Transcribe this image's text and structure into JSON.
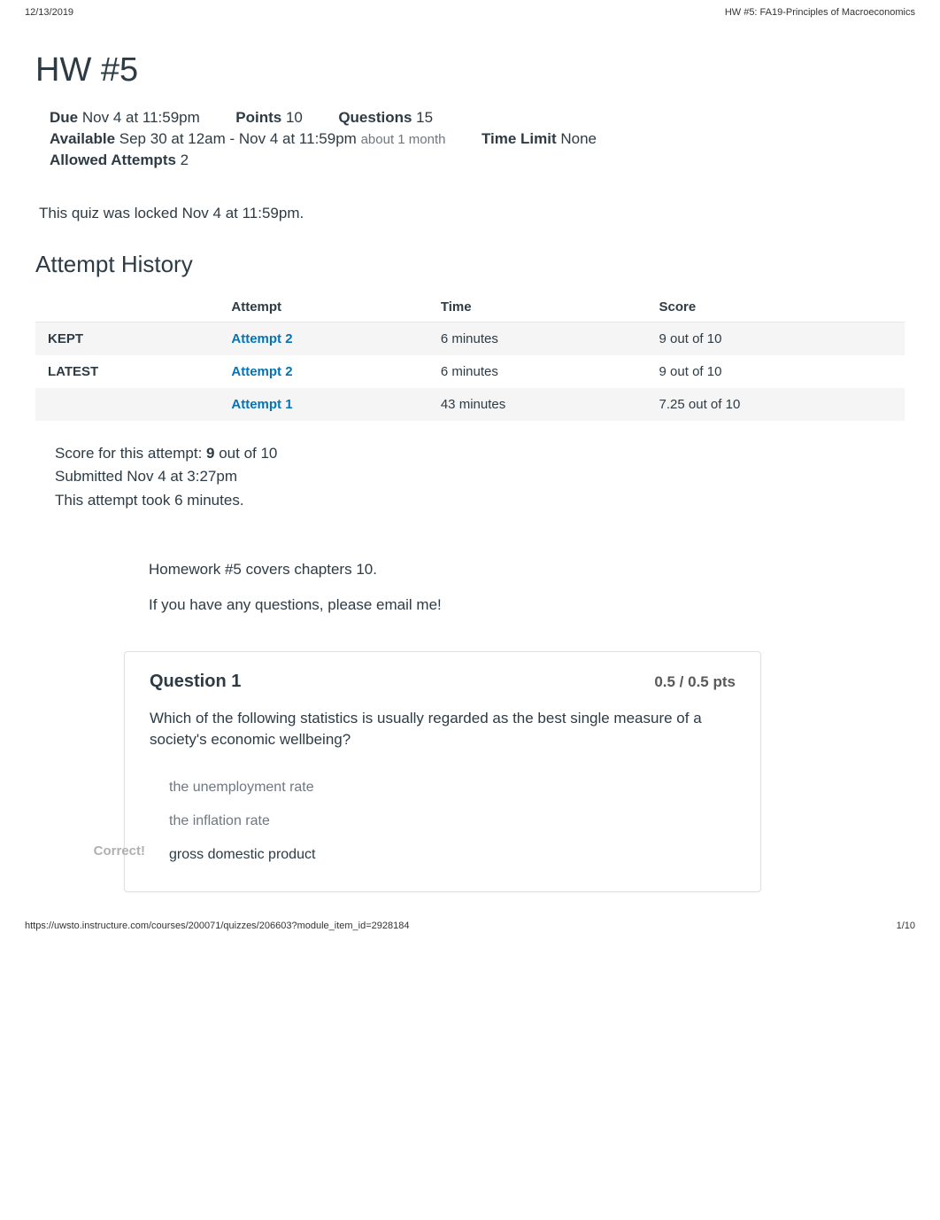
{
  "print": {
    "date": "12/13/2019",
    "title": "HW #5: FA19-Principles of Macroeconomics",
    "footerUrl": "https://uwsto.instructure.com/courses/200071/quizzes/206603?module_item_id=2928184",
    "pageNum": "1/10"
  },
  "page": {
    "title": "HW #5"
  },
  "meta": {
    "dueLabel": "Due",
    "dueValue": "Nov 4 at 11:59pm",
    "pointsLabel": "Points",
    "pointsValue": "10",
    "questionsLabel": "Questions",
    "questionsValue": "15",
    "availableLabel": "Available",
    "availableValue": "Sep 30 at 12am - Nov 4 at 11:59pm",
    "availableSuffix": "about 1 month",
    "timeLimitLabel": "Time Limit",
    "timeLimitValue": "None",
    "allowedLabel": "Allowed Attempts",
    "allowedValue": "2"
  },
  "lockedText": "This quiz was locked Nov 4 at 11:59pm.",
  "history": {
    "title": "Attempt History",
    "headers": {
      "status": "",
      "attempt": "Attempt",
      "time": "Time",
      "score": "Score"
    },
    "rows": [
      {
        "status": "KEPT",
        "attemptLabel": "Attempt 2",
        "time": "6 minutes",
        "score": "9 out of 10"
      },
      {
        "status": "LATEST",
        "attemptLabel": "Attempt 2",
        "time": "6 minutes",
        "score": "9 out of 10"
      },
      {
        "status": "",
        "attemptLabel": "Attempt 1",
        "time": "43 minutes",
        "score": "7.25 out of 10"
      }
    ]
  },
  "scoreBlock": {
    "scorePrefix": "Score for this attempt: ",
    "scoreVal": "9",
    "scoreSuffix": " out of 10",
    "submitted": "Submitted Nov 4 at 3:27pm",
    "duration": "This attempt took 6 minutes."
  },
  "intro": {
    "line1": "Homework #5 covers chapters 10.",
    "line2": "If you have any questions, please email me!"
  },
  "question1": {
    "title": "Question 1",
    "pts": "0.5 / 0.5 pts",
    "prompt": "Which of the following statistics is usually regarded as the best single measure of a society's economic wellbeing?",
    "optA": "the unemployment rate",
    "optB": "the inflation rate",
    "optC": "gross domestic product",
    "correctLabel": "Correct!"
  }
}
